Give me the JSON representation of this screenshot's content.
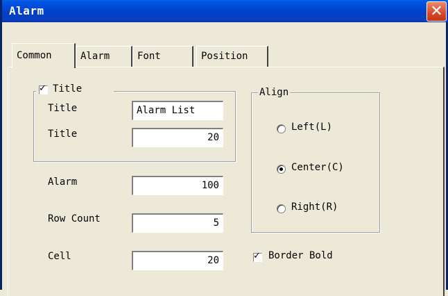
{
  "window": {
    "title": "Alarm",
    "close_glyph": "✕"
  },
  "tabs": [
    {
      "label": "Common",
      "active": true
    },
    {
      "label": "Alarm",
      "active": false
    },
    {
      "label": "Font",
      "active": false
    },
    {
      "label": "Position",
      "active": false
    }
  ],
  "title_group": {
    "checkbox_label": "Title",
    "checked": true,
    "rows": [
      {
        "label": "Title",
        "value": "Alarm List"
      },
      {
        "label": "Title",
        "value": "20"
      }
    ]
  },
  "fields": [
    {
      "label": "Alarm",
      "value": "100"
    },
    {
      "label": "Row Count",
      "value": "5"
    },
    {
      "label": "Cell",
      "value": "20"
    }
  ],
  "align": {
    "label": "Align",
    "options": [
      {
        "label": "Left(L)",
        "checked": false
      },
      {
        "label": "Center(C)",
        "checked": true
      },
      {
        "label": "Right(R)",
        "checked": false
      }
    ]
  },
  "border_bold": {
    "label": "Border Bold",
    "checked": true
  },
  "icons": {
    "close": "close-icon",
    "check": "check-icon"
  },
  "colors": {
    "titlebar": "#0040c8",
    "close": "#d6492a",
    "face": "#ece9d8"
  }
}
